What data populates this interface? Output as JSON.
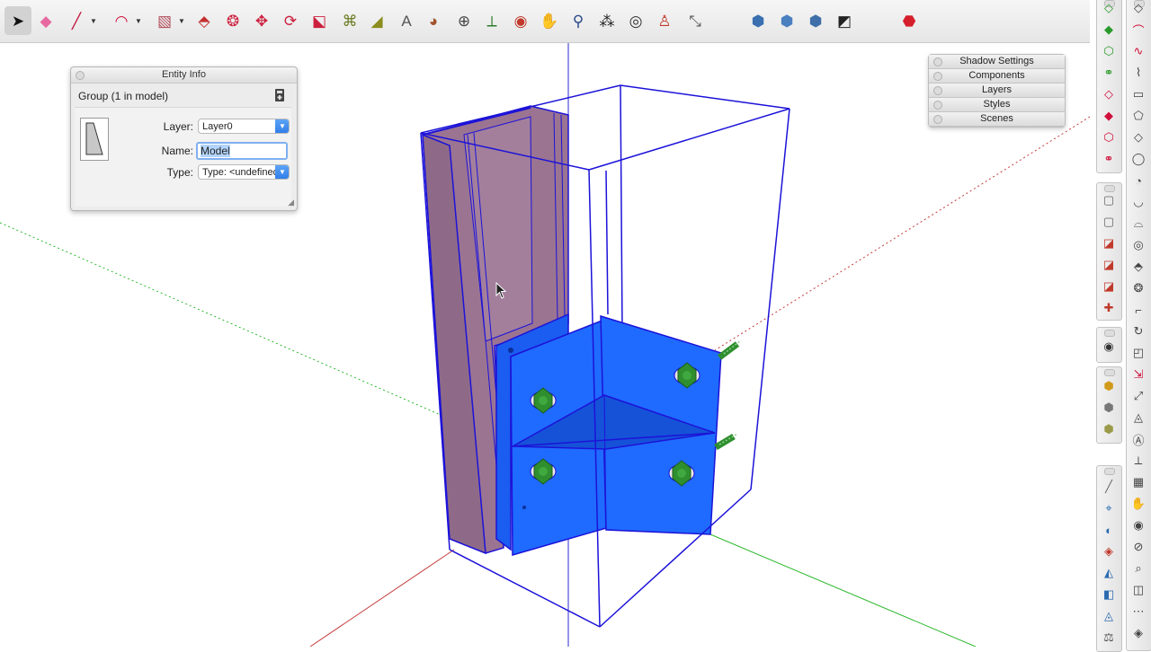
{
  "toolbar": {
    "tools": [
      {
        "name": "select-tool",
        "glyph": "➤",
        "color": "#111",
        "active": true
      },
      {
        "name": "eraser-tool",
        "glyph": "◆",
        "color": "#e66aa0"
      },
      {
        "name": "line-tool",
        "glyph": "╱",
        "color": "#c0143c",
        "menu": true
      },
      {
        "name": "arc-tool",
        "glyph": "◠",
        "color": "#d0103a",
        "menu": true
      },
      {
        "name": "rectangle-tool",
        "glyph": "▧",
        "color": "#b14b5a",
        "menu": true
      },
      {
        "name": "push-pull-tool",
        "glyph": "⬘",
        "color": "#c43030"
      },
      {
        "name": "follow-me-tool",
        "glyph": "❂",
        "color": "#cc1f3d"
      },
      {
        "name": "move-tool",
        "glyph": "✥",
        "color": "#cc1f3d"
      },
      {
        "name": "rotate-tool",
        "glyph": "⟳",
        "color": "#cc1f3d"
      },
      {
        "name": "scale-tool",
        "glyph": "⬕",
        "color": "#cc1f3d"
      },
      {
        "name": "offset-tool",
        "glyph": "⌘",
        "color": "#6a7b22"
      },
      {
        "name": "tape-measure-tool",
        "glyph": "◢",
        "color": "#8c8c1f"
      },
      {
        "name": "text-tool",
        "glyph": "A",
        "color": "#555"
      },
      {
        "name": "paint-bucket-tool",
        "glyph": "◕",
        "color": "#a0522d"
      },
      {
        "name": "orbit-tool",
        "glyph": "⊕",
        "color": "#444"
      },
      {
        "name": "axes-tool",
        "glyph": "⟂",
        "color": "#2a7b2a"
      },
      {
        "name": "section-plane-tool",
        "glyph": "◉",
        "color": "#c0392b"
      },
      {
        "name": "pan-tool",
        "glyph": "✋",
        "color": "#c77d1a"
      },
      {
        "name": "zoom-tool",
        "glyph": "⚲",
        "color": "#2a4a8a"
      },
      {
        "name": "walk-tool",
        "glyph": "⁂",
        "color": "#222"
      },
      {
        "name": "look-around-tool",
        "glyph": "◎",
        "color": "#333"
      },
      {
        "name": "position-camera-tool",
        "glyph": "♙",
        "color": "#c0392b"
      },
      {
        "name": "dimension-tool",
        "glyph": "⤡",
        "color": "#555"
      },
      {
        "name": "warehouse-tool",
        "glyph": "⬢",
        "color": "#3a6fb0"
      },
      {
        "name": "share-model-tool",
        "glyph": "⬢",
        "color": "#4a7fc0"
      },
      {
        "name": "extension-warehouse-tool",
        "glyph": "⬢",
        "color": "#3f6fa8"
      },
      {
        "name": "send-to-layout-tool",
        "glyph": "◩",
        "color": "#222"
      },
      {
        "name": "ruby-console-tool",
        "glyph": "⬣",
        "color": "#d61f2c"
      }
    ]
  },
  "entity_info": {
    "title": "Entity Info",
    "header": "Group (1 in model)",
    "layer_label": "Layer:",
    "layer_value": "Layer0",
    "name_label": "Name:",
    "name_value": "Model",
    "type_label": "Type:",
    "type_value": "Type: <undefined>"
  },
  "tray": {
    "items": [
      "Shadow Settings",
      "Components",
      "Layers",
      "Styles",
      "Scenes"
    ]
  },
  "right_strip_a": [
    {
      "name": "views-top-icon",
      "glyph": "◇",
      "color": "#2a9a2a"
    },
    {
      "name": "views-front-icon",
      "glyph": "◆",
      "color": "#2a9a2a"
    },
    {
      "name": "component-icon",
      "glyph": "⬡",
      "color": "#2a9a2a"
    },
    {
      "name": "groups-icon",
      "glyph": "⚭",
      "color": "#2a9a2a"
    },
    {
      "name": "outer-shell-icon",
      "glyph": "◇",
      "color": "#d0103a"
    },
    {
      "name": "solid-icon",
      "glyph": "◆",
      "color": "#d0103a"
    },
    {
      "name": "intersect-icon",
      "glyph": "⬡",
      "color": "#d0103a"
    },
    {
      "name": "union-icon",
      "glyph": "⚭",
      "color": "#d0103a"
    }
  ],
  "right_strip_b": [
    {
      "name": "view-iso-icon",
      "glyph": "▢",
      "color": "#666"
    },
    {
      "name": "view-top-icon",
      "glyph": "▢",
      "color": "#666"
    },
    {
      "name": "view-front-icon",
      "glyph": "◪",
      "color": "#c0392b"
    },
    {
      "name": "view-right-icon",
      "glyph": "◪",
      "color": "#c0392b"
    },
    {
      "name": "view-back-icon",
      "glyph": "◪",
      "color": "#c0392b"
    },
    {
      "name": "view-left-icon",
      "glyph": "✚",
      "color": "#c0392b"
    }
  ],
  "right_strip_c": [
    {
      "name": "geo-location-icon",
      "glyph": "◉",
      "color": "#333"
    }
  ],
  "right_strip_d": [
    {
      "name": "style-xray-icon",
      "glyph": "⬢",
      "color": "#d29a1a"
    },
    {
      "name": "style-wireframe-icon",
      "glyph": "⬢",
      "color": "#777"
    },
    {
      "name": "style-shaded-icon",
      "glyph": "⬢",
      "color": "#9a9a4a"
    }
  ],
  "right_strip_e": [
    {
      "name": "sandbox-smoove-icon",
      "glyph": "╱",
      "color": "#666"
    },
    {
      "name": "sandbox-stamp-icon",
      "glyph": "⌖",
      "color": "#2a6ab0"
    },
    {
      "name": "sandbox-drape-icon",
      "glyph": "◐",
      "color": "#2a6ab0"
    },
    {
      "name": "sandbox-add-detail-icon",
      "glyph": "◈",
      "color": "#c0392b"
    },
    {
      "name": "sandbox-flip-edge-icon",
      "glyph": "◭",
      "color": "#2a6ab0"
    },
    {
      "name": "sandbox-from-contours-icon",
      "glyph": "◧",
      "color": "#2a6ab0"
    },
    {
      "name": "sandbox-from-scratch-icon",
      "glyph": "◬",
      "color": "#2a6ab0"
    },
    {
      "name": "sandbox-measure-icon",
      "glyph": "⚖",
      "color": "#555"
    }
  ],
  "right_strip_f": [
    {
      "name": "draw-line-icon",
      "glyph": "◇",
      "color": "#444"
    },
    {
      "name": "draw-arc-icon",
      "glyph": "⌒",
      "color": "#d0103a"
    },
    {
      "name": "draw-curve-icon",
      "glyph": "∿",
      "color": "#d0103a"
    },
    {
      "name": "draw-freehand-icon",
      "glyph": "⌇",
      "color": "#444"
    },
    {
      "name": "draw-box-icon",
      "glyph": "▭",
      "color": "#444"
    },
    {
      "name": "draw-polygon-icon",
      "glyph": "⬠",
      "color": "#444"
    },
    {
      "name": "draw-rotated-rect-icon",
      "glyph": "◇",
      "color": "#444"
    },
    {
      "name": "draw-circle-icon",
      "glyph": "◯",
      "color": "#444"
    },
    {
      "name": "draw-pie-icon",
      "glyph": "◔",
      "color": "#444"
    },
    {
      "name": "draw-3pt-arc-icon",
      "glyph": "◡",
      "color": "#444"
    },
    {
      "name": "draw-2pt-arc-icon",
      "glyph": "⌓",
      "color": "#444"
    },
    {
      "name": "modify-offset-icon",
      "glyph": "◎",
      "color": "#444"
    },
    {
      "name": "modify-pushpull-icon",
      "glyph": "⬘",
      "color": "#444"
    },
    {
      "name": "modify-followme-icon",
      "glyph": "❂",
      "color": "#444"
    },
    {
      "name": "modify-move-icon",
      "glyph": "⌐",
      "color": "#444"
    },
    {
      "name": "modify-rotate-icon",
      "glyph": "↻",
      "color": "#444"
    },
    {
      "name": "modify-scale-icon",
      "glyph": "◰",
      "color": "#444"
    },
    {
      "name": "measure-tape-icon",
      "glyph": "⇲",
      "color": "#d0103a"
    },
    {
      "name": "measure-dim-icon",
      "glyph": "⤢",
      "color": "#444"
    },
    {
      "name": "measure-protractor-icon",
      "glyph": "◬",
      "color": "#444"
    },
    {
      "name": "measure-text-icon",
      "glyph": "Ⓐ",
      "color": "#444"
    },
    {
      "name": "measure-axes-icon",
      "glyph": "⟂",
      "color": "#444"
    },
    {
      "name": "measure-3dtext-icon",
      "glyph": "▦",
      "color": "#444"
    },
    {
      "name": "camera-orbit-icon",
      "glyph": "✋",
      "color": "#444"
    },
    {
      "name": "camera-pan-icon",
      "glyph": "◉",
      "color": "#444"
    },
    {
      "name": "camera-zoom-icon",
      "glyph": "⊘",
      "color": "#444"
    },
    {
      "name": "camera-zoom-window-icon",
      "glyph": "⌕",
      "color": "#444"
    },
    {
      "name": "camera-zoom-extents-icon",
      "glyph": "◫",
      "color": "#444"
    },
    {
      "name": "camera-walk-icon",
      "glyph": "⋯",
      "color": "#444"
    },
    {
      "name": "section-plane-icon",
      "glyph": "◈",
      "color": "#444"
    }
  ],
  "colors": {
    "selection_blue": "#1c12d8",
    "plate_blue": "#1f6bff",
    "plate_blue_dark": "#1552d8",
    "column_purple": "#9b7492",
    "bolt_green": "#2f8f2f",
    "axis_red": "#c43a3a",
    "axis_green": "#2fb82f",
    "axis_blue": "#2b2bd0"
  }
}
